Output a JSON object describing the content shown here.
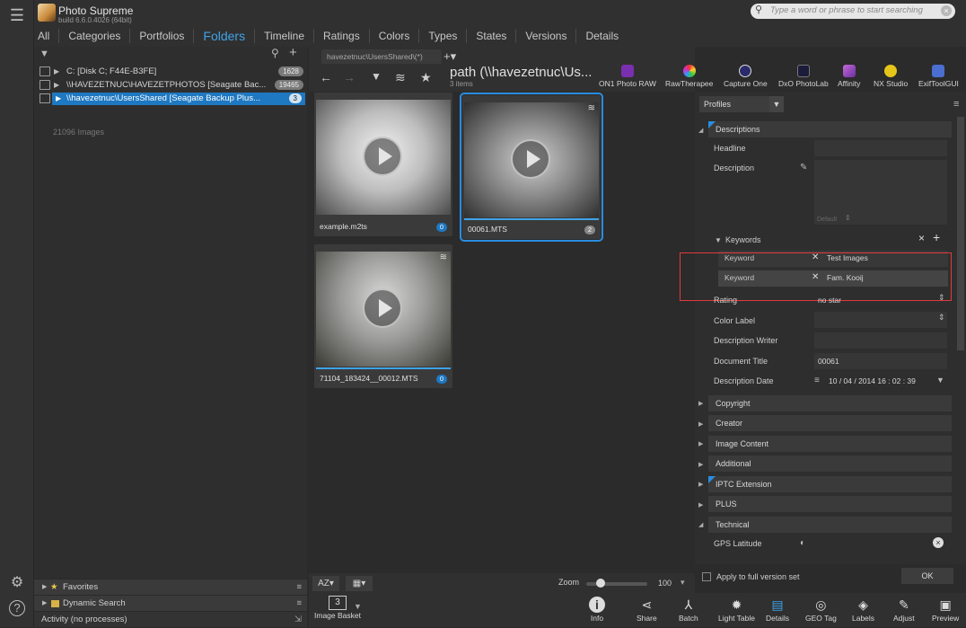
{
  "app": {
    "title": "Photo Supreme",
    "build": "build 6.6.0.4026 (64bit)"
  },
  "search": {
    "placeholder": "Type a word or phrase to start searching"
  },
  "navtabs": [
    "All",
    "Categories",
    "Portfolios",
    "Folders",
    "Timeline",
    "Ratings",
    "Colors",
    "Types",
    "States",
    "Versions",
    "Details"
  ],
  "tree": [
    {
      "label": "C:  [Disk C; F44E-B3FE]",
      "count": "1628"
    },
    {
      "label": "\\\\HAVEZETNUC\\HAVEZETPHOTOS  [Seagate Bac...",
      "count": "19465"
    },
    {
      "label": "\\\\havezetnuc\\UsersShared  [Seagate Backup Plus...",
      "count": "3"
    }
  ],
  "left": {
    "image_count": "21096 Images",
    "favorites": "Favorites",
    "dynamic_search": "Dynamic Search",
    "activity": "Activity (no processes)"
  },
  "center": {
    "path_tab": "havezetnuc\\UsersShared\\(*)",
    "path_title": "path (\\\\havezetnuc\\Us...",
    "path_sub": "3 items",
    "zoom_label": "Zoom",
    "zoom_value": "100",
    "sort_label": "AZ",
    "basket_count": "3",
    "basket_label": "Image Basket"
  },
  "apps": [
    "ON1 Photo RAW",
    "RawTherapee",
    "Capture One",
    "DxO PhotoLab",
    "Affinity",
    "NX Studio",
    "ExifToolGUI"
  ],
  "thumbs": [
    {
      "name": "example.m2ts",
      "count": "0"
    },
    {
      "name": "00061.MTS",
      "count": "2"
    },
    {
      "name": "71104_183424__00012.MTS",
      "count": "0"
    }
  ],
  "right": {
    "profiles": "Profiles",
    "sec_descriptions": "Descriptions",
    "headline": "Headline",
    "description": "Description",
    "default": "Default",
    "keywords": "Keywords",
    "kw_label": "Keyword",
    "kw1": "Test Images",
    "kw2": "Fam. Kooij",
    "rating": "Rating",
    "rating_val": "no star",
    "color_label": "Color Label",
    "desc_writer": "Description Writer",
    "doc_title": "Document Title",
    "doc_title_val": "00061",
    "desc_date": "Description Date",
    "desc_date_val": "10 / 04 / 2014    16 : 02 : 39",
    "sections": [
      "Copyright",
      "Creator",
      "Image Content",
      "Additional",
      "IPTC Extension",
      "PLUS",
      "Technical"
    ],
    "gps_lat": "GPS Latitude",
    "apply_full": "Apply to full version set",
    "ok": "OK"
  },
  "bottom": [
    "Info",
    "Share",
    "Batch",
    "Light Table",
    "Details",
    "GEO Tag",
    "Labels",
    "Adjust",
    "Preview"
  ]
}
